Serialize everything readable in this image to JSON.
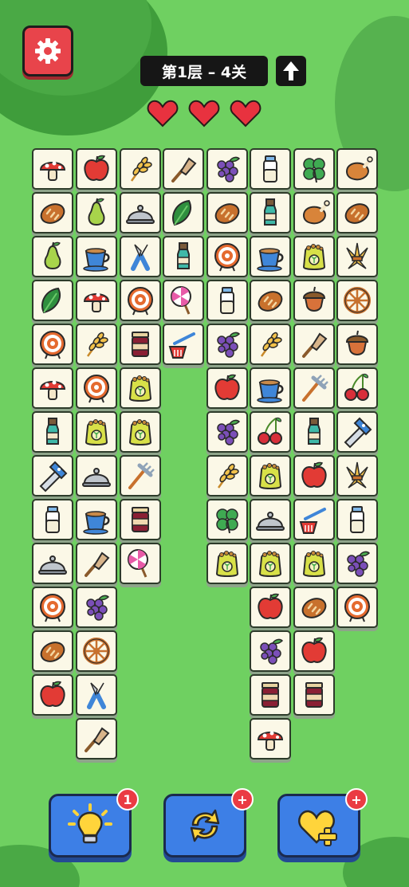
{
  "level_text": "第1层 – 4关",
  "lives": 3,
  "tiles": [
    {
      "type": "mushroom"
    },
    {
      "type": "apple"
    },
    {
      "type": "wheat"
    },
    {
      "type": "scoop"
    },
    {
      "type": "grapes"
    },
    {
      "type": "milk"
    },
    {
      "type": "clover"
    },
    {
      "type": "chicken"
    },
    {
      "type": "bread"
    },
    {
      "type": "pear"
    },
    {
      "type": "cloche"
    },
    {
      "type": "spinach"
    },
    {
      "type": "bread"
    },
    {
      "type": "bottle"
    },
    {
      "type": "chicken"
    },
    {
      "type": "bread"
    },
    {
      "type": "pear"
    },
    {
      "type": "cup"
    },
    {
      "type": "pruner"
    },
    {
      "type": "bottle"
    },
    {
      "type": "target"
    },
    {
      "type": "cup"
    },
    {
      "type": "seedbag"
    },
    {
      "type": "hay"
    },
    {
      "type": "spinach"
    },
    {
      "type": "mushroom"
    },
    {
      "type": "target"
    },
    {
      "type": "lollipop"
    },
    {
      "type": "milk"
    },
    {
      "type": "bread"
    },
    {
      "type": "acorn"
    },
    {
      "type": "wheel"
    },
    {
      "type": "target"
    },
    {
      "type": "wheat"
    },
    {
      "type": "jam"
    },
    {
      "type": "dustpan"
    },
    {
      "type": "grapes"
    },
    {
      "type": "wheat"
    },
    {
      "type": "scoop"
    },
    {
      "type": "acorn"
    },
    {
      "type": "mushroom"
    },
    {
      "type": "target"
    },
    {
      "type": "seedbag"
    },
    {
      "type": "apple"
    },
    {
      "type": "cup"
    },
    {
      "type": "rake"
    },
    {
      "type": "cherry"
    },
    {
      "type": "bottle"
    },
    {
      "type": "seedbag"
    },
    {
      "type": "seedbag"
    },
    {
      "type": "grapes"
    },
    {
      "type": "cherry"
    },
    {
      "type": "bottle"
    },
    {
      "type": "saw"
    },
    {
      "type": "saw"
    },
    {
      "type": "cloche"
    },
    {
      "type": "rake"
    },
    {
      "type": "wheat"
    },
    {
      "type": "seedbag"
    },
    {
      "type": "apple"
    },
    {
      "type": "hay"
    },
    {
      "type": "milk"
    },
    {
      "type": "cup"
    },
    {
      "type": "jam"
    },
    {
      "type": "clover"
    },
    {
      "type": "cloche"
    },
    {
      "type": "dustpan"
    },
    {
      "type": "milk"
    },
    {
      "type": "cloche"
    },
    {
      "type": "scoop"
    },
    {
      "type": "lollipop"
    },
    {
      "type": "seedbag"
    },
    {
      "type": "seedbag"
    },
    {
      "type": "seedbag"
    },
    {
      "type": "grapes"
    },
    {
      "type": "target"
    },
    {
      "type": "grapes"
    },
    {
      "type": "apple"
    },
    {
      "type": "bread"
    },
    {
      "type": "target"
    },
    {
      "type": "bread"
    },
    {
      "type": "wheel"
    },
    {
      "type": "grapes"
    },
    {
      "type": "apple"
    },
    {
      "type": "apple"
    },
    {
      "type": "pruner"
    },
    {
      "type": "jam"
    },
    {
      "type": "jam"
    },
    {
      "type": "scoop"
    },
    {
      "type": "mushroom"
    }
  ],
  "buttons": {
    "hint": {
      "badge": "1"
    },
    "shuffle": {
      "badge": "+"
    },
    "life": {
      "badge": "+"
    }
  }
}
